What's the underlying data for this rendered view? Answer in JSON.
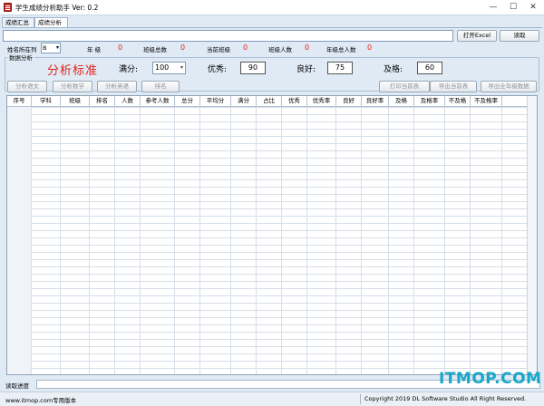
{
  "window": {
    "title": "学生成绩分析助手 Ver: 0.2",
    "min": "—",
    "max": "☐",
    "close": "✕"
  },
  "tabs": [
    {
      "label": "成绩汇总"
    },
    {
      "label": "成绩分析"
    }
  ],
  "toolbar": {
    "path_value": "",
    "open_excel": "打开Excel",
    "read": "读取"
  },
  "info": {
    "name_col_label": "姓名所在列",
    "name_col_value": "B",
    "grade_label": "年  级",
    "grade_value": "0",
    "class_total_label": "班级总数",
    "class_total_value": "0",
    "current_class_label": "当前班级",
    "current_class_value": "0",
    "class_count_label": "班级人数",
    "class_count_value": "0",
    "grade_total_label": "年级总人数",
    "grade_total_value": "0"
  },
  "analysis": {
    "group_label": "数据分析",
    "title": "分析标准",
    "full_label": "满分:",
    "full_value": "100",
    "excellent_label": "优秀:",
    "excellent_value": "90",
    "good_label": "良好:",
    "good_value": "75",
    "pass_label": "及格:",
    "pass_value": "60",
    "buttons": {
      "chinese": "分析语文",
      "math": "分析数学",
      "english": "分析英语",
      "rank": "排名",
      "print": "打印当前表",
      "export_current": "导出当前表",
      "export_all": "导出全年级数据"
    }
  },
  "table": {
    "columns": [
      "序号",
      "学科",
      "班级",
      "排名",
      "人数",
      "参考人数",
      "总分",
      "平均分",
      "满分",
      "占比",
      "优秀",
      "优秀率",
      "良好",
      "良好率",
      "及格",
      "及格率",
      "不及格",
      "不及格率"
    ]
  },
  "progress": {
    "label": "读取进度"
  },
  "status": {
    "left": "www.itmop.com专用版本",
    "right": "Copyright 2019 DL Software Studio All Right Reserved."
  },
  "watermark": "ITMOP.COM",
  "colors": {
    "accent_red": "#e0241a",
    "watermark": "#17a8c9",
    "background": "#dfeaf5"
  }
}
